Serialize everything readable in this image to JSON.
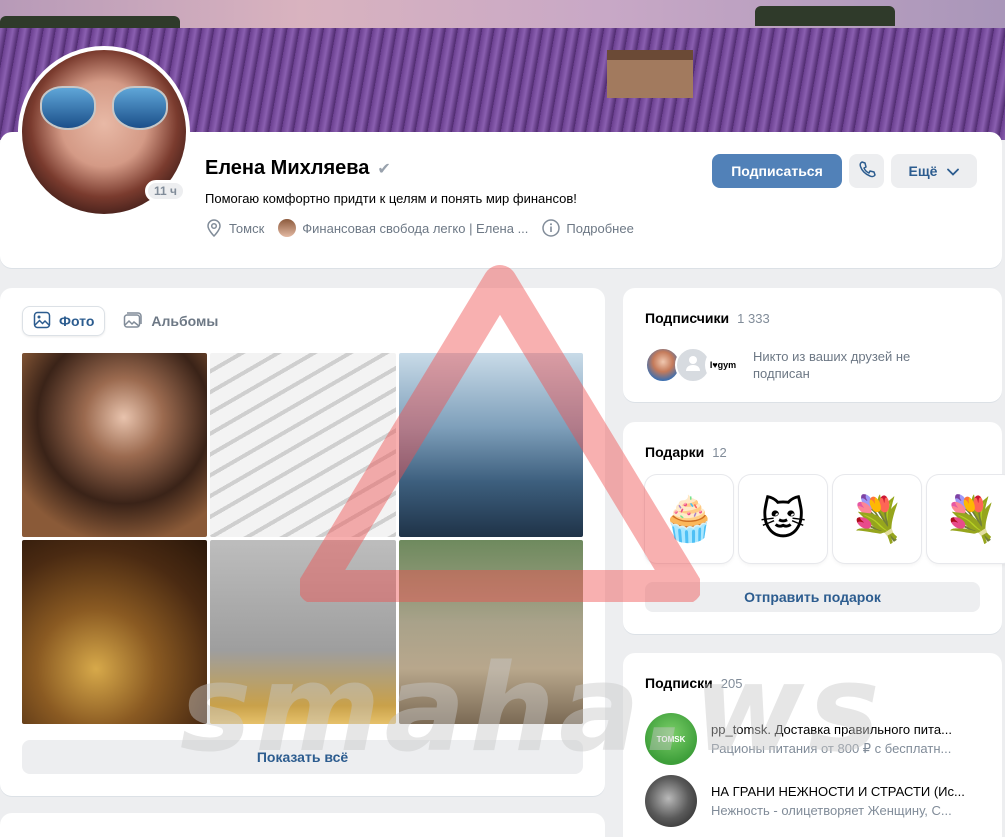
{
  "profile": {
    "name": "Елена Михляева",
    "status": "Помогаю комфортно придти к целям и понять мир финансов!",
    "online_badge": "11 ч",
    "city": "Томск",
    "community": "Финансовая свобода легко | Елена ...",
    "details": "Подробнее"
  },
  "actions": {
    "subscribe": "Подписаться",
    "more": "Ещё"
  },
  "photos": {
    "tabs": [
      {
        "label": "Фото",
        "active": true
      },
      {
        "label": "Альбомы",
        "active": false
      }
    ],
    "show_all": "Показать всё"
  },
  "subscribers": {
    "title": "Подписчики",
    "count": "1 333",
    "friends_note": "Никто из ваших друзей не подписан",
    "gym_label": "I♥gym"
  },
  "gifts": {
    "title": "Подарки",
    "count": "12",
    "items": [
      "🧁",
      "🐱",
      "💐",
      "💐"
    ],
    "send": "Отправить подарок"
  },
  "following": {
    "title": "Подписки",
    "count": "205",
    "items": [
      {
        "name": "pp_tomsk. Доставка правильного пита...",
        "desc": "Рационы питания от 800 ₽ с бесплатн...",
        "avatar_label": "TOMSK"
      },
      {
        "name": "НА ГРАНИ НЕЖНОСТИ И СТРАСТИ (Ис...",
        "desc": "Нежность - олицетворяет Женщину, С..."
      }
    ]
  },
  "watermark": "smaha.ws",
  "colors": {
    "accent": "#5181b8",
    "link": "#2c5c8f",
    "page_bg": "#edeef0",
    "secondary_text": "#818c99"
  }
}
